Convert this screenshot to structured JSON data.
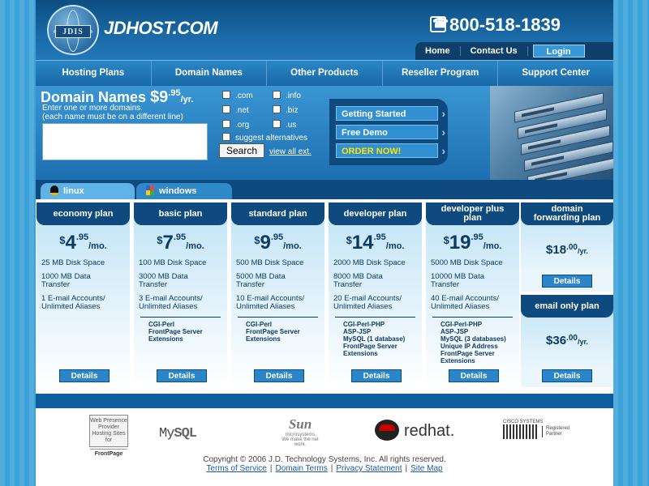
{
  "brand": {
    "name": "JDHOST.COM",
    "monogram": "JDIS"
  },
  "phone": "800-518-1839",
  "top_links": {
    "home": "Home",
    "contact": "Contact Us",
    "login": "Login"
  },
  "nav": [
    "Hosting Plans",
    "Domain Names",
    "Other Products",
    "Reseller Program",
    "Support Center"
  ],
  "domain_search": {
    "title": "Domain Names",
    "price_dollar": "$9",
    "price_cents": ".95",
    "price_per": "/yr.",
    "help_line1": "Enter one or more domains.",
    "help_line2": "(each name must be on a different line)",
    "tlds": [
      ".com",
      ".info",
      ".net",
      ".biz",
      ".org",
      ".us"
    ],
    "suggest": "suggest alternatives",
    "search_button": "Search",
    "view_all": "view all ext."
  },
  "cta": {
    "getting_started": "Getting Started",
    "free_demo": "Free Demo",
    "order_now": "ORDER NOW!"
  },
  "os_tabs": {
    "linux": "linux",
    "windows": "windows"
  },
  "plans": [
    {
      "name": "economy plan",
      "dollar": "$",
      "price": "4",
      "cents": ".95",
      "per": "/mo.",
      "disk": "25 MB Disk Space",
      "transfer_1": "1000 MB Data",
      "transfer_2": "Transfer",
      "email_1": "1 E-mail Accounts/",
      "email_2": "Unlimited Aliases",
      "extras": [],
      "details": "Details"
    },
    {
      "name": "basic plan",
      "dollar": "$",
      "price": "7",
      "cents": ".95",
      "per": "/mo.",
      "disk": "100 MB Disk Space",
      "transfer_1": "3000 MB Data",
      "transfer_2": "Transfer",
      "email_1": "3 E-mail Accounts/",
      "email_2": "Unlimited Aliases",
      "extras": [
        "CGI-Perl",
        "FrontPage Server",
        "Extensions"
      ],
      "details": "Details"
    },
    {
      "name": "standard plan",
      "dollar": "$",
      "price": "9",
      "cents": ".95",
      "per": "/mo.",
      "disk": "500 MB Disk Space",
      "transfer_1": "5000 MB Data",
      "transfer_2": "Transfer",
      "email_1": "10 E-mail Accounts/",
      "email_2": "Unlimited Aliases",
      "extras": [
        "CGI-Perl",
        "FrontPage Server",
        "Extensions"
      ],
      "details": "Details"
    },
    {
      "name": "developer plan",
      "dollar": "$",
      "price": "14",
      "cents": ".95",
      "per": "/mo.",
      "disk": "2000 MB Disk Space",
      "transfer_1": "8000 MB Data",
      "transfer_2": "Transfer",
      "email_1": "20 E-mail Accounts/",
      "email_2": "Unlimited Aliases",
      "extras": [
        "CGI-Perl-PHP",
        "ASP-JSP",
        "MySQL (1 database)",
        "FrontPage Server",
        "Extensions"
      ],
      "details": "Details"
    },
    {
      "name_1": "developer plus",
      "name_2": "plan",
      "dollar": "$",
      "price": "19",
      "cents": ".95",
      "per": "/mo.",
      "disk": "5000 MB Disk Space",
      "transfer_1": "10000 MB Data",
      "transfer_2": "Transfer",
      "email_1": "40 E-mail Accounts/",
      "email_2": "Unlimited Aliases",
      "extras": [
        "CGI-Perl-PHP",
        "ASP-JSP",
        "MySQL (3 databases)",
        "Unique IP Address",
        "FrontPage Server",
        "Extensions"
      ],
      "details": "Details"
    }
  ],
  "domain_forwarding": {
    "title_1": "domain",
    "title_2": "forwarding plan",
    "price": "$18",
    "cents": ".00",
    "per": "/yr.",
    "details": "Details"
  },
  "email_only": {
    "title": "email only plan",
    "price": "$36",
    "cents": ".00",
    "per": "/yr.",
    "details": "Details"
  },
  "partners": {
    "frontpage_top": "Web Presence Provider",
    "frontpage_mid": "Hosting Sites for",
    "frontpage_name": "FrontPage",
    "mysql_a": "My",
    "mysql_b": "SQL",
    "sun": "Sun",
    "sun_sub": "microsystems",
    "sun_tag": "We make the net work.",
    "redhat": "redhat.",
    "cisco_name": "CISCO SYSTEMS",
    "cisco_reg1": "Registered",
    "cisco_reg2": "Partner"
  },
  "footer": {
    "copyright": "Copyright © 2006 J.D. Technology Systems, Inc. All rights reserved.",
    "links": [
      "Terms of Service",
      "Domain Terms",
      "Privacy Statement",
      "Site Map"
    ]
  }
}
